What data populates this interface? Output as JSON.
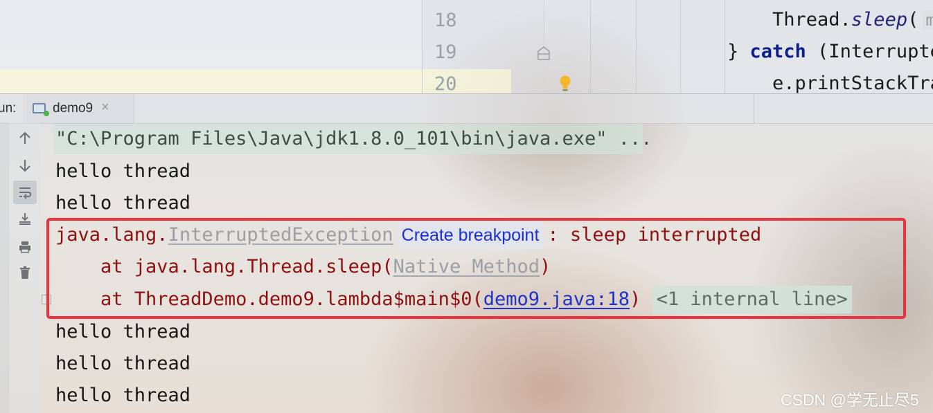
{
  "editor": {
    "lines": [
      {
        "number": "18",
        "code_prefix": "Thread.",
        "code_method": "sleep",
        "code_suffix": "(",
        "hint": "m"
      },
      {
        "number": "19",
        "brace": "} ",
        "keyword": "catch",
        "rest": " (Interrupte"
      },
      {
        "number": "20",
        "code": "e.printStackTra"
      }
    ],
    "gutter_icons": [
      "bookmark-icon",
      "bulb-icon"
    ]
  },
  "run_panel": {
    "label": "un:",
    "tab": {
      "name": "demo9",
      "close": "×"
    }
  },
  "toolbar": {
    "buttons": [
      "up-arrow-icon",
      "down-arrow-icon",
      "soft-wrap-icon",
      "scroll-to-end-icon",
      "print-icon",
      "trash-icon"
    ]
  },
  "console": {
    "command": "\"C:\\Program Files\\Java\\jdk1.8.0_101\\bin\\java.exe\" ...",
    "line1": "hello thread",
    "line2": "hello thread",
    "exception": {
      "package": "java.lang.",
      "class": "InterruptedException",
      "create_breakpoint": "Create breakpoint",
      "message": ": sleep interrupted"
    },
    "stack1": {
      "prefix": "    at java.lang.Thread.sleep(",
      "native": "Native Method",
      "suffix": ")"
    },
    "stack2": {
      "prefix": "    at ThreadDemo.demo9.lambda$main$0(",
      "link": "demo9.java:18",
      "suffix": ")",
      "internal": "<1 internal line>"
    },
    "line3": "hello thread",
    "line4": "hello thread",
    "line5": "hello thread"
  },
  "watermark": "CSDN @学无止尽5",
  "colors": {
    "error": "#8e1111",
    "link": "#1c34c8",
    "highlight_frame": "#e8323d"
  }
}
